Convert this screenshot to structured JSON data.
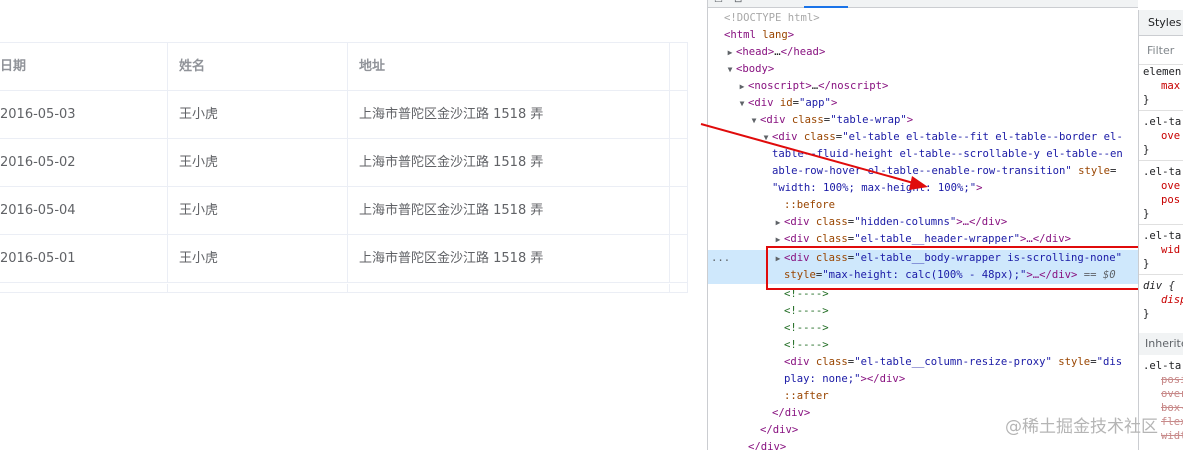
{
  "table": {
    "headers": [
      "日期",
      "姓名",
      "地址"
    ],
    "rows": [
      [
        "2016-05-03",
        "王小虎",
        "上海市普陀区金沙江路 1518 弄"
      ],
      [
        "2016-05-02",
        "王小虎",
        "上海市普陀区金沙江路 1518 弄"
      ],
      [
        "2016-05-04",
        "王小虎",
        "上海市普陀区金沙江路 1518 弄"
      ],
      [
        "2016-05-01",
        "王小虎",
        "上海市普陀区金沙江路 1518 弄"
      ]
    ]
  },
  "devtools": {
    "tab_icons": [
      "☐",
      "⊟"
    ],
    "dom_lines": [
      {
        "text": "<!DOCTYPE html>"
      },
      {
        "open": "<html",
        "attr": " lang",
        "close": ">"
      },
      {
        "open": "<head>",
        "mid": "…",
        "close": "</head>"
      },
      {
        "open": "<body>"
      },
      {
        "open": "<noscript>",
        "mid": "…",
        "close": "</noscript>"
      },
      {
        "open": "<div",
        "attr": " id",
        "eq": "=",
        "val": "\"app\"",
        "close": ">"
      },
      {
        "open": "<div",
        "attr": " class",
        "eq": "=",
        "val": "\"table-wrap\"",
        "close": ">"
      },
      {
        "open": "<div",
        "attr": " class",
        "eq": "=",
        "val": "\"el-table el-table--fit el-table--border el-"
      },
      {
        "val": "table--fluid-height el-table--scrollable-y el-table--en"
      },
      {
        "val": "able-row-hover el-table--enable-row-transition\"",
        "attr": " style",
        "eq": "="
      },
      {
        "val": "\"width: 100%; max-height: 100%;\"",
        "close": ">"
      },
      {
        "pseudo": "::before"
      },
      {
        "open": "<div",
        "attr": " class",
        "eq": "=",
        "val": "\"hidden-columns\"",
        "close": ">…</div>"
      },
      {
        "open": "<div",
        "attr": " class",
        "eq": "=",
        "val": "\"el-table__header-wrapper\"",
        "close": ">…</div>"
      },
      {
        "open": "<div",
        "attr": " class",
        "eq": "=",
        "val": "\"el-table__body-wrapper is-scrolling-none\""
      },
      {
        "attr": "style",
        "eq": "=",
        "val": "\"max-height: calc(100% - 48px);\"",
        "close": ">…</div>",
        "eq0": " == $0"
      },
      {
        "comment": "<!---->"
      },
      {
        "comment": "<!---->"
      },
      {
        "comment": "<!---->"
      },
      {
        "comment": "<!---->"
      },
      {
        "open": "<div",
        "attr": " class",
        "eq": "=",
        "val": "\"el-table__column-resize-proxy\"",
        "attr2": " style",
        "eq2": "=",
        "val2": "\"dis"
      },
      {
        "val": "play: none;\"",
        "close": "></div>"
      },
      {
        "pseudo": "::after"
      },
      {
        "close": "</div>"
      },
      {
        "close": "</div>"
      },
      {
        "close": "</div>"
      }
    ],
    "selected_marker": "...",
    "triangles": [
      "▶",
      "▼"
    ]
  },
  "styles_pane": {
    "tab": "Styles",
    "filter_placeholder": "Filter",
    "rules": [
      {
        "selector": "elemen",
        "props": [
          "max"
        ],
        "brace": "}"
      },
      {
        "selector": ".el-ta",
        "props": [
          "ove"
        ],
        "brace": "}"
      },
      {
        "selector": ".el-ta",
        "props": [
          "ove",
          "pos"
        ],
        "brace": "}"
      },
      {
        "selector": ".el-ta",
        "props": [
          "wid"
        ],
        "brace": "}"
      },
      {
        "selector": "div {",
        "props": [
          "disp"
        ],
        "brace": "}"
      }
    ],
    "inherited_label": "Inherite",
    "inherited_rule": {
      "selector": ".el-ta",
      "props": [
        "posi",
        "over",
        "box-",
        "flex",
        "widt"
      ]
    }
  },
  "watermark": "@稀土掘金技术社区",
  "colors": {
    "annotation_red": "#e00b0b",
    "selected_row": "#cfe8fc"
  }
}
